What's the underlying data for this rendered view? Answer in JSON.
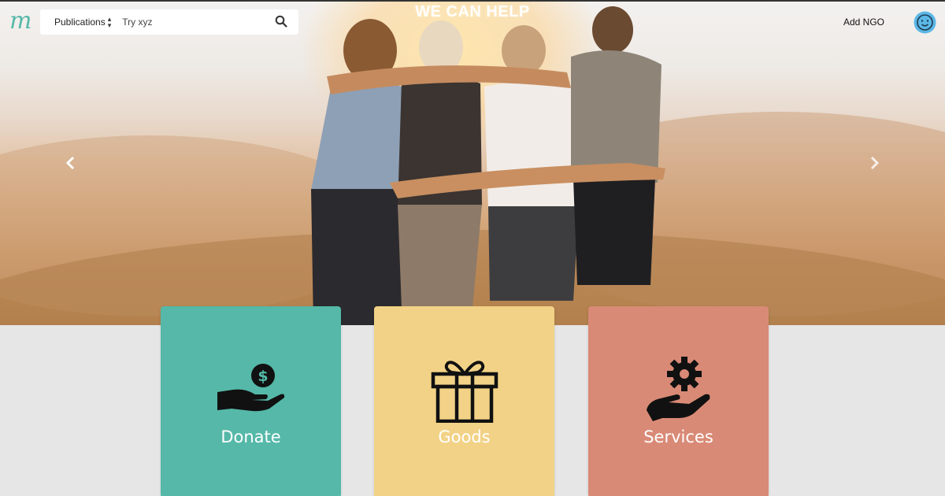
{
  "hero": {
    "title": "WE CAN HELP",
    "prev_arrow_icon": "chevron-left-icon",
    "next_arrow_icon": "chevron-right-icon"
  },
  "navbar": {
    "logo_text": "m",
    "search": {
      "category": "Publications",
      "placeholder": "Try xyz",
      "value": "",
      "icon": "search-icon"
    },
    "add_ngo_label": "Add NGO",
    "avatar_icon": "smiley-avatar-icon"
  },
  "cards": [
    {
      "label": "Donate",
      "icon": "hand-coin-icon",
      "color": "#55b8a8"
    },
    {
      "label": "Goods",
      "icon": "gift-icon",
      "color": "#f2d286"
    },
    {
      "label": "Services",
      "icon": "hand-gear-icon",
      "color": "#d98a76"
    }
  ],
  "colors": {
    "page_background": "#e6e6e6",
    "brand": "#55b9a8",
    "avatar": "#5bb7e6"
  }
}
